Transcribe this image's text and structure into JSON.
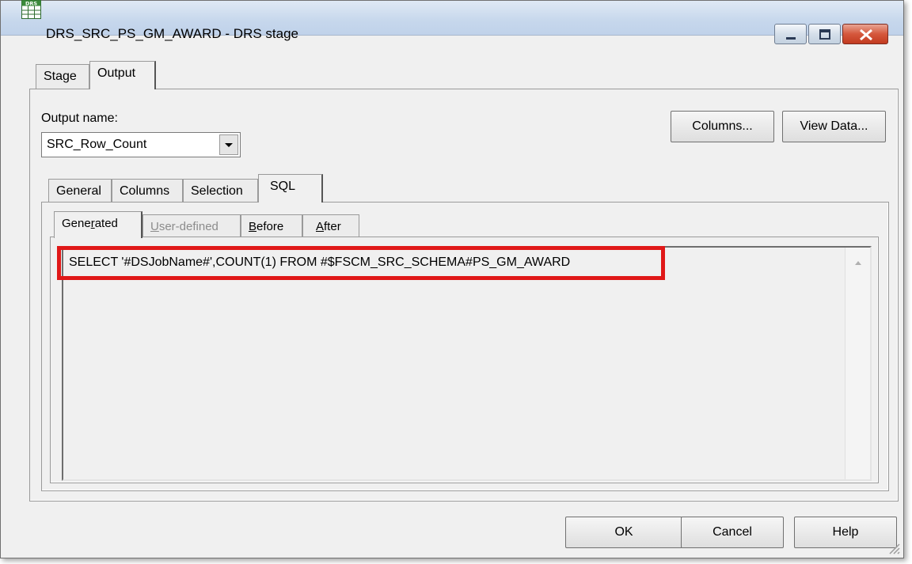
{
  "window": {
    "title": "DRS_SRC_PS_GM_AWARD - DRS stage",
    "icon_label": "DRS"
  },
  "outer_tabs": [
    {
      "label": "Stage"
    },
    {
      "label": "Output"
    }
  ],
  "output_name": {
    "label": "Output name:",
    "value": "SRC_Row_Count"
  },
  "top_buttons": {
    "columns": "Columns...",
    "view_data": "View Data..."
  },
  "inner_tabs": [
    {
      "label": "General"
    },
    {
      "label": "Columns"
    },
    {
      "label": "Selection"
    },
    {
      "label": "SQL"
    }
  ],
  "sql_tabs": [
    {
      "label_pre": "Gene",
      "label_ul": "r",
      "label_post": "ated"
    },
    {
      "label_pre": "",
      "label_ul": "U",
      "label_post": "ser-defined"
    },
    {
      "label_pre": "",
      "label_ul": "B",
      "label_post": "efore"
    },
    {
      "label_pre": "",
      "label_ul": "A",
      "label_post": "fter"
    }
  ],
  "sql": {
    "text": "SELECT '#DSJobName#',COUNT(1) FROM #$FSCM_SRC_SCHEMA#PS_GM_AWARD"
  },
  "bottom_buttons": {
    "ok": "OK",
    "cancel": "Cancel",
    "help": "Help"
  },
  "colors": {
    "highlight": "#e01818",
    "window_bg": "#f0f0f0"
  }
}
